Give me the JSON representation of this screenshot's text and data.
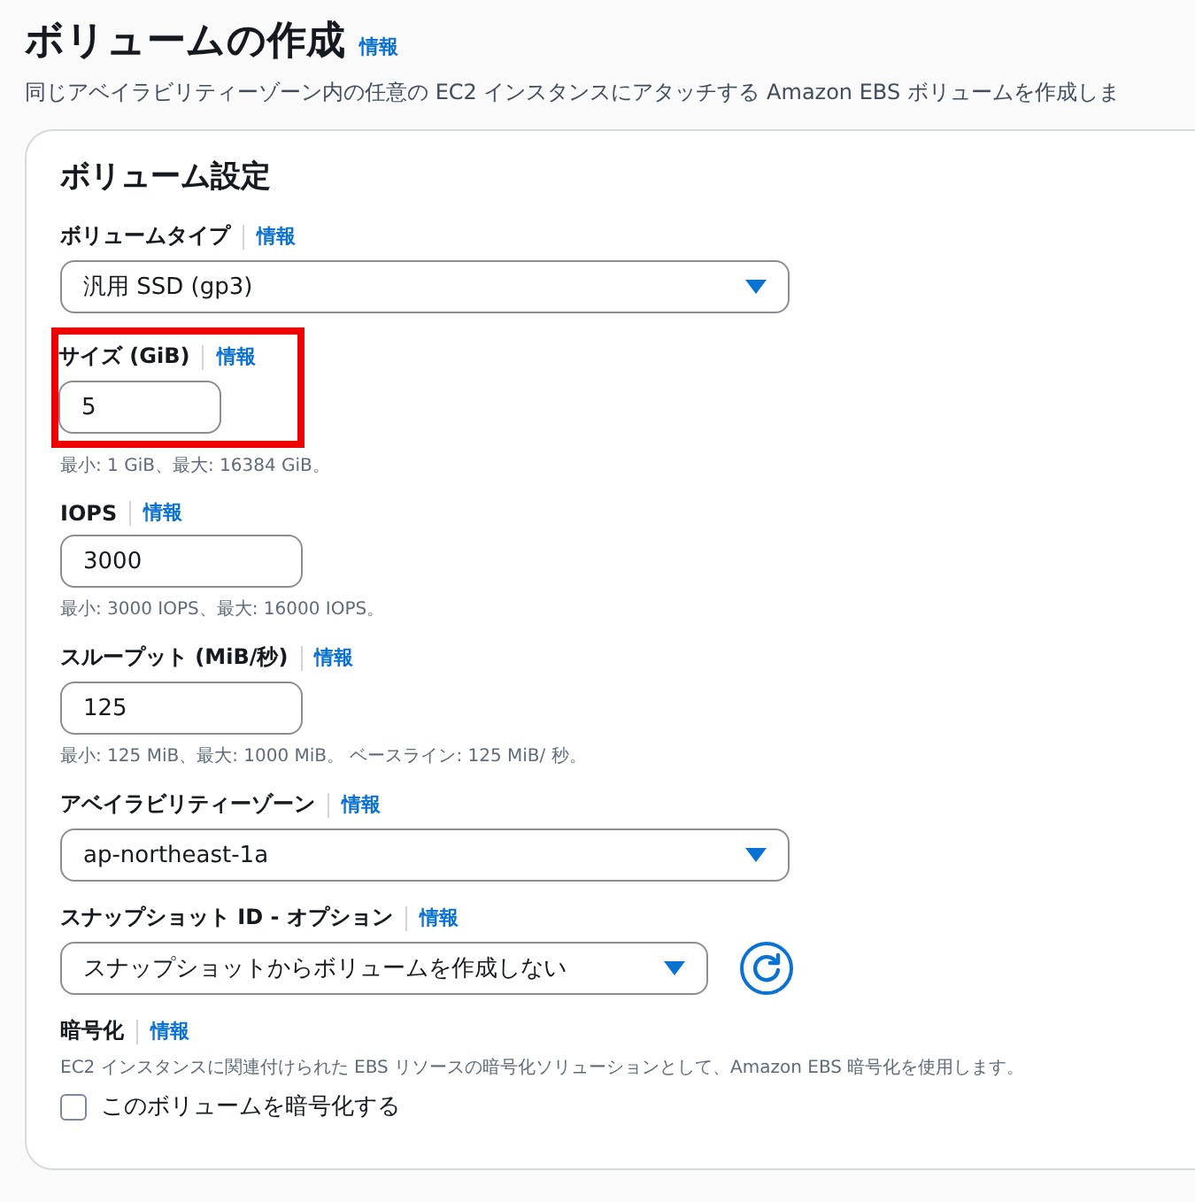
{
  "header": {
    "title": "ボリュームの作成",
    "info": "情報",
    "description": "同じアベイラビリティーゾーン内の任意の EC2 インスタンスにアタッチする Amazon EBS ボリュームを作成しま"
  },
  "card": {
    "title": "ボリューム設定",
    "fields": [
      {
        "kind": "select",
        "label": "ボリュームタイプ",
        "info": "情報",
        "value": "汎用 SSD (gp3)"
      },
      {
        "kind": "input",
        "label": "サイズ (GiB)",
        "info": "情報",
        "value": "5",
        "hint": "最小: 1 GiB、最大: 16384 GiB。",
        "highlighted": true
      },
      {
        "kind": "input",
        "label": "IOPS",
        "info": "情報",
        "value": "3000",
        "hint": "最小: 3000 IOPS、最大: 16000 IOPS。",
        "highlighted": false
      },
      {
        "kind": "input",
        "label": "スループット (MiB/秒)",
        "info": "情報",
        "value": "125",
        "hint": "最小: 125 MiB、最大: 1000 MiB。 ベースライン: 125 MiB/ 秒。",
        "highlighted": false
      },
      {
        "kind": "select",
        "label": "アベイラビリティーゾーン",
        "info": "情報",
        "value": "ap-northeast-1a"
      },
      {
        "kind": "select-refresh",
        "label": "スナップショット ID - オプション",
        "info": "情報",
        "value": "スナップショットからボリュームを作成しない"
      },
      {
        "kind": "checkbox",
        "label": "暗号化",
        "info": "情報",
        "description": "EC2 インスタンスに関連付けられた EBS リソースの暗号化ソリューションとして、Amazon EBS 暗号化を使用します。",
        "checkbox_label": "このボリュームを暗号化する",
        "checked": false
      }
    ]
  }
}
